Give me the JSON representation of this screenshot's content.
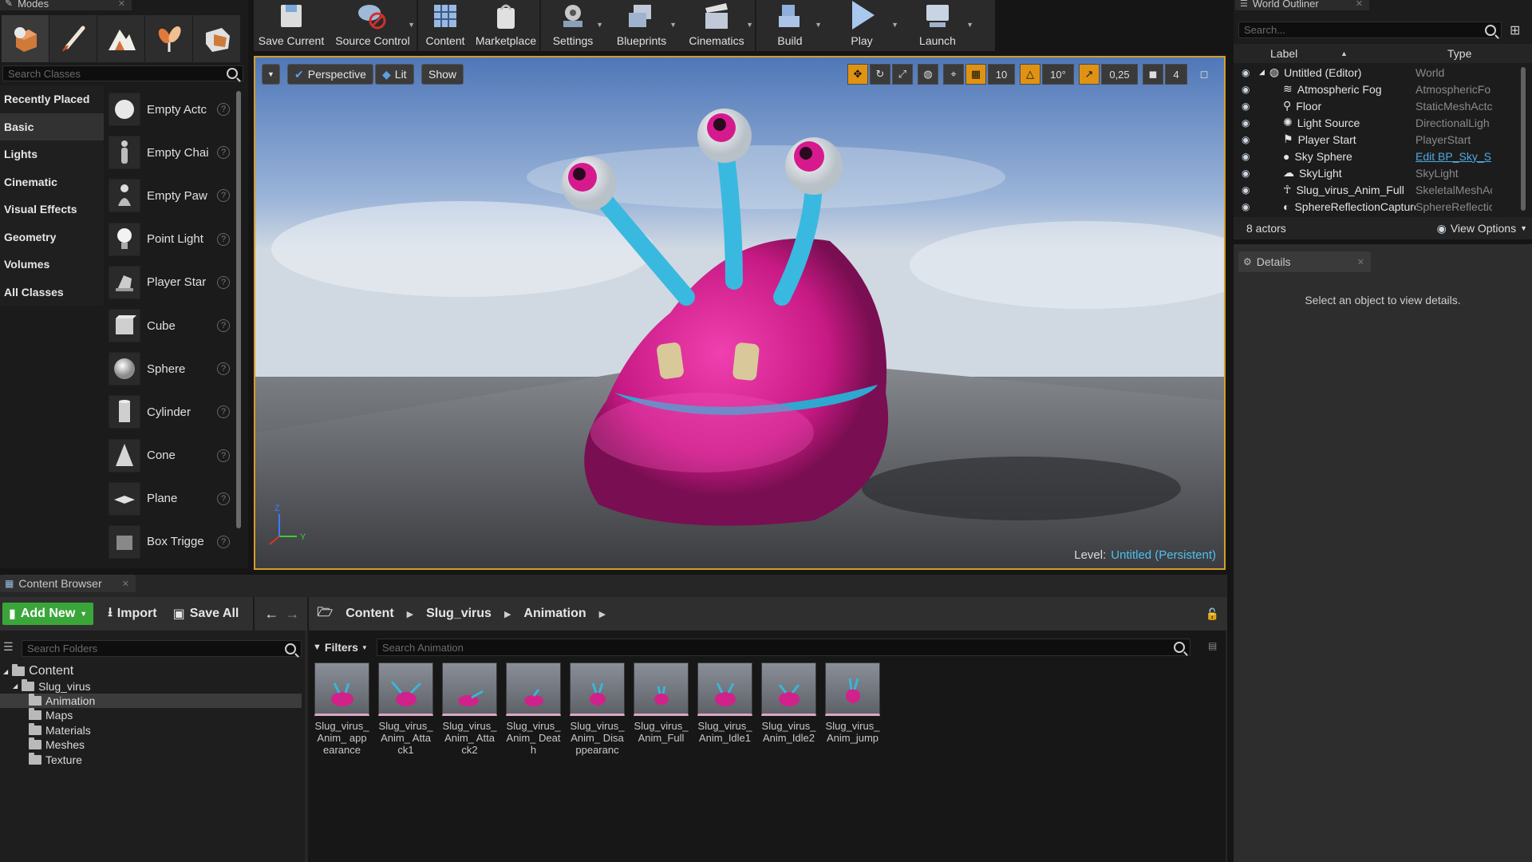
{
  "modes": {
    "tab_title": "Modes",
    "search_placeholder": "Search Classes",
    "categories": [
      "Recently Placed",
      "Basic",
      "Lights",
      "Cinematic",
      "Visual Effects",
      "Geometry",
      "Volumes",
      "All Classes"
    ],
    "active_category": "Basic",
    "items": [
      "Empty Actc",
      "Empty Chai",
      "Empty Paw",
      "Point Light",
      "Player Star",
      "Cube",
      "Sphere",
      "Cylinder",
      "Cone",
      "Plane",
      "Box Trigge"
    ]
  },
  "toolbar": {
    "buttons": [
      "Save Current",
      "Source Control",
      "Content",
      "Marketplace",
      "Settings",
      "Blueprints",
      "Cinematics",
      "Build",
      "Play",
      "Launch"
    ]
  },
  "viewport": {
    "perspective_label": "Perspective",
    "lit_label": "Lit",
    "show_label": "Show",
    "grid_snap": "10",
    "rotation_snap": "10°",
    "scale_snap": "0,25",
    "camera_speed": "4",
    "level_label": "Level:",
    "level_name": "Untitled (Persistent)"
  },
  "outliner": {
    "tab_title": "World Outliner",
    "search_placeholder": "Search...",
    "col_label": "Label",
    "col_type": "Type",
    "rows": [
      {
        "label": "Untitled (Editor)",
        "type": "World"
      },
      {
        "label": "Atmospheric Fog",
        "type": "AtmosphericFo"
      },
      {
        "label": "Floor",
        "type": "StaticMeshActc"
      },
      {
        "label": "Light Source",
        "type": "DirectionalLigh"
      },
      {
        "label": "Player Start",
        "type": "PlayerStart"
      },
      {
        "label": "Sky Sphere",
        "type": "Edit BP_Sky_S"
      },
      {
        "label": "SkyLight",
        "type": "SkyLight"
      },
      {
        "label": "Slug_virus_Anim_Full",
        "type": "SkeletalMeshAc"
      },
      {
        "label": "SphereReflectionCapture",
        "type": "SphereReflectic"
      }
    ],
    "actor_count": "8 actors",
    "view_options": "View Options"
  },
  "details": {
    "tab_title": "Details",
    "message": "Select an object to view details."
  },
  "content_browser": {
    "tab_title": "Content Browser",
    "add_new": "Add New",
    "import": "Import",
    "save_all": "Save All",
    "breadcrumb": [
      "Content",
      "Slug_virus",
      "Animation"
    ],
    "folder_search_placeholder": "Search Folders",
    "filters_label": "Filters",
    "asset_search_placeholder": "Search Animation",
    "tree": [
      {
        "label": "Content",
        "level": 0
      },
      {
        "label": "Slug_virus",
        "level": 1
      },
      {
        "label": "Animation",
        "level": 2
      },
      {
        "label": "Maps",
        "level": 2
      },
      {
        "label": "Materials",
        "level": 2
      },
      {
        "label": "Meshes",
        "level": 2
      },
      {
        "label": "Texture",
        "level": 2
      }
    ],
    "assets": [
      "Slug_virus_ Anim_ appearance",
      "Slug_virus_ Anim_ Attack1",
      "Slug_virus_ Anim_ Attack2",
      "Slug_virus_ Anim_ Death",
      "Slug_virus_ Anim_ Disappearanc",
      "Slug_virus_ Anim_Full",
      "Slug_virus_ Anim_Idle1",
      "Slug_virus_ Anim_Idle2",
      "Slug_virus_ Anim_jump"
    ]
  },
  "colors": {
    "viewport_border": "#d69c2a",
    "add_new_green": "#3aa63a",
    "link_blue": "#4fc0f0",
    "creature_pink": "#d0228a",
    "creature_blue": "#3cb4d8"
  }
}
